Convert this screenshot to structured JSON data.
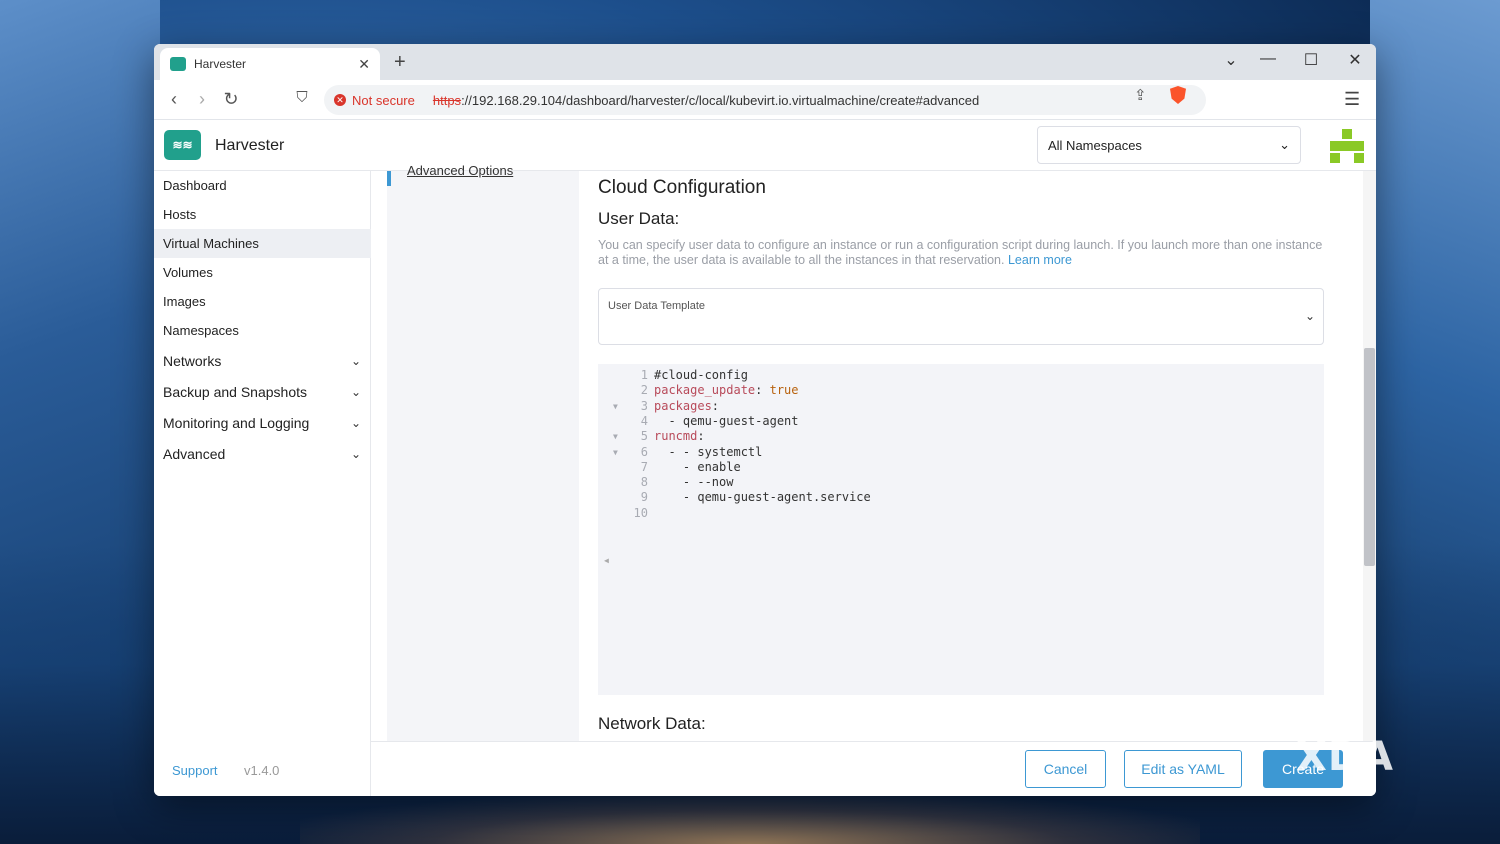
{
  "browser": {
    "tab_title": "Harvester",
    "security_label": "Not secure",
    "url_scheme": "https",
    "url_rest": "://192.168.29.104/dashboard/harvester/c/local/kubevirt.io.virtualmachine/create#advanced"
  },
  "app": {
    "name": "Harvester",
    "namespace_select": "All Namespaces",
    "brand_color": "#21a08c",
    "accent_color": "#3d98d3"
  },
  "sidebar": {
    "items": [
      {
        "label": "Dashboard"
      },
      {
        "label": "Hosts"
      },
      {
        "label": "Virtual Machines"
      },
      {
        "label": "Volumes"
      },
      {
        "label": "Images"
      },
      {
        "label": "Namespaces"
      },
      {
        "label": "Networks"
      },
      {
        "label": "Backup and Snapshots"
      },
      {
        "label": "Monitoring and Logging"
      },
      {
        "label": "Advanced"
      }
    ],
    "support": "Support",
    "version": "v1.4.0"
  },
  "subnav": {
    "current": "Advanced Options"
  },
  "main": {
    "section_title": "Cloud Configuration",
    "user_data_title": "User Data:",
    "help_text": "You can specify user data to configure an instance or run a configuration script during launch. If you launch more than one instance at a time, the user data is available to all the instances in that reservation.",
    "learn_more": "Learn more",
    "template_label": "User Data Template",
    "network_data_title": "Network Data:"
  },
  "editor": {
    "lines": [
      {
        "n": "1",
        "text": "#cloud-config"
      },
      {
        "n": "2",
        "key": "package_update",
        "sep": ": ",
        "val": "true"
      },
      {
        "n": "3",
        "key": "packages",
        "sep": ":"
      },
      {
        "n": "4",
        "text": "  - qemu-guest-agent"
      },
      {
        "n": "5",
        "key": "runcmd",
        "sep": ":"
      },
      {
        "n": "6",
        "text": "  - - systemctl"
      },
      {
        "n": "7",
        "text": "    - enable"
      },
      {
        "n": "8",
        "text": "    - --now"
      },
      {
        "n": "9",
        "text": "    - qemu-guest-agent.service"
      },
      {
        "n": "10",
        "text": ""
      }
    ]
  },
  "footer": {
    "cancel": "Cancel",
    "edit_yaml": "Edit as YAML",
    "create": "Create"
  },
  "watermark": "XDA"
}
